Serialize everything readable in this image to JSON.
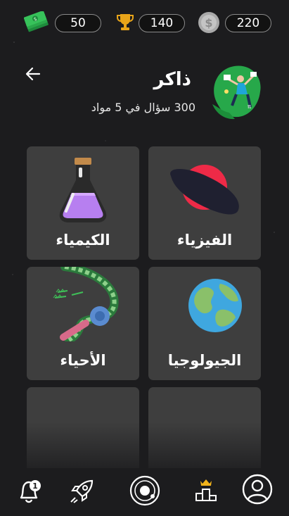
{
  "stats": {
    "cash": "50",
    "trophies": "140",
    "coins": "220"
  },
  "header": {
    "title": "ذاكر",
    "subtitle": "300 سؤال في 5 مواد"
  },
  "subjects": [
    {
      "label": "الفيزياء",
      "icon": "saturn-icon"
    },
    {
      "label": "الكيمياء",
      "icon": "flask-icon"
    },
    {
      "label": "الجيولوجيا",
      "icon": "globe-icon"
    },
    {
      "label": "الأحياء",
      "icon": "dna-icon"
    },
    {
      "label": "",
      "icon": ""
    },
    {
      "label": "",
      "icon": ""
    }
  ],
  "nav": {
    "notification_count": "1",
    "items": [
      "notifications-icon",
      "rocket-icon",
      "planet-orbit-icon",
      "leaderboard-icon",
      "profile-icon"
    ]
  },
  "colors": {
    "background": "#1c1c1e",
    "card": "#3e3e3e",
    "trophy": "#e8a419",
    "crown": "#f2b41b"
  }
}
